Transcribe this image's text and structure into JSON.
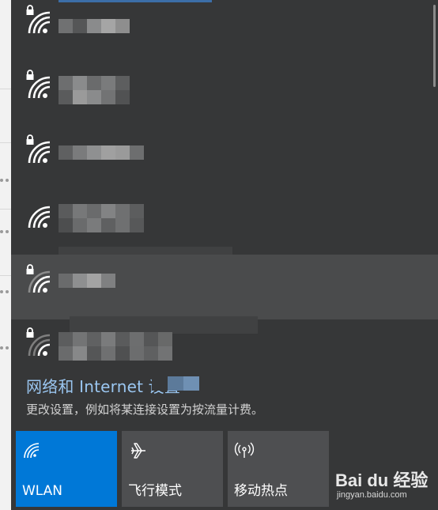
{
  "settings": {
    "link_text": "网络和 Internet 设置",
    "description": "更改设置，例如将某连接设置为按流量计费。"
  },
  "quick_actions": [
    {
      "label": "WLAN",
      "icon": "wifi-icon",
      "active": true
    },
    {
      "label": "飞行模式",
      "icon": "airplane-icon",
      "active": false
    },
    {
      "label": "移动热点",
      "icon": "hotspot-icon",
      "active": false
    }
  ],
  "watermark": {
    "brand": "Bai du 经验",
    "url": "jingyan.baidu.com"
  },
  "colors": {
    "flyout_bg": "#363738",
    "accent": "#0078d7",
    "link": "#9ac6f0",
    "tile_bg": "#4e4f51"
  }
}
